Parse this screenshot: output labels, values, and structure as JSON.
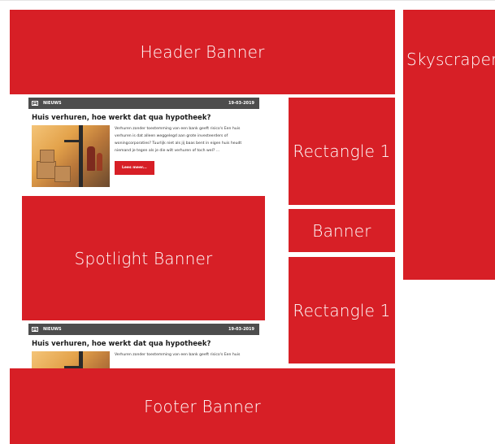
{
  "ad_slots": {
    "header_banner": "Header Banner",
    "skyscraper": "Skyscraper",
    "rectangle_top": "Rectangle 1",
    "banner": "Banner",
    "rectangle_bottom": "Rectangle 1",
    "spotlight_banner": "Spotlight Banner",
    "footer_banner": "Footer Banner"
  },
  "news_card": {
    "section_label": "NIEUWS",
    "date": "19-03-2019",
    "title": "Huis verhuren, hoe werkt dat qua hypotheek?",
    "body": "Verhuren zonder toestemming van een bank geeft risico's Een huis verhuren is dat alleen weggelegd aan grote investeerders of woningcorporaties? Tuurlijk niet als jij baas bent in eigen huis heudt niemand je tegen als je die wilt verhuren of toch wel? ...",
    "body_short": "Verhuren zonder toestemming van een bank geeft risico's Een huis",
    "button_label": "Lees meer..."
  },
  "colors": {
    "ad_red": "#d71f26",
    "news_bar": "#4d4d4d",
    "background": "#ffffff"
  },
  "icons": {
    "news_section_icon": "newspaper-icon"
  }
}
